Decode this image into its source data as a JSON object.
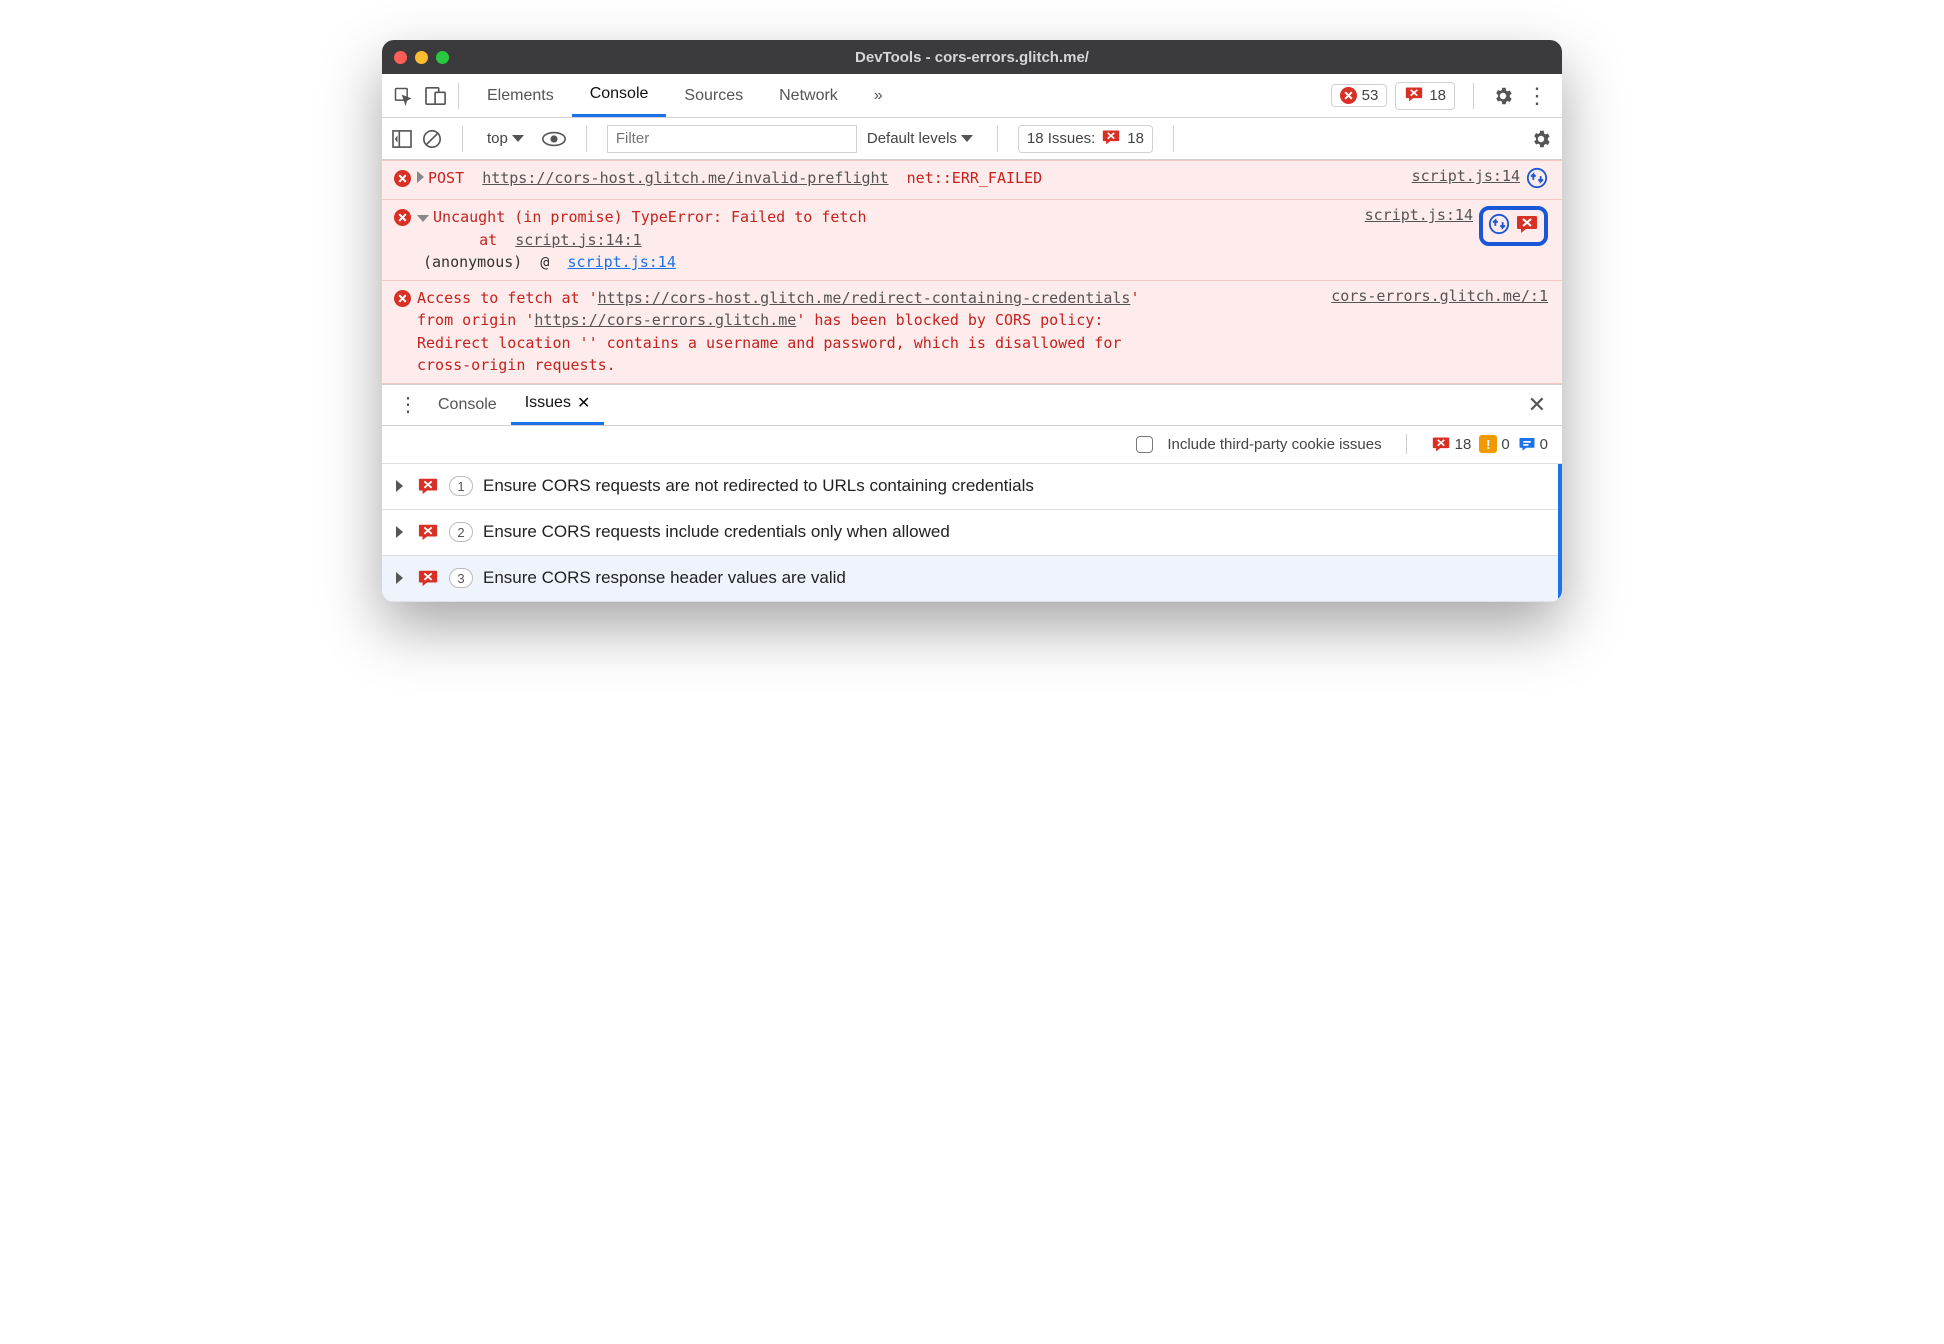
{
  "title": "DevTools - cors-errors.glitch.me/",
  "toolbar": {
    "tabs": [
      "Elements",
      "Console",
      "Sources",
      "Network"
    ],
    "active_tab": "Console",
    "overflow": "»",
    "error_count": "53",
    "issue_count": "18"
  },
  "subtoolbar": {
    "context": "top",
    "filter_placeholder": "Filter",
    "levels_label": "Default levels",
    "issues_label": "18 Issues:",
    "issues_count": "18"
  },
  "messages": {
    "m1": {
      "method": "POST",
      "url": "https://cors-host.glitch.me/invalid-preflight",
      "err": "net::ERR_FAILED",
      "source": "script.js:14"
    },
    "m2": {
      "text": "Uncaught (in promise) TypeError: Failed to fetch",
      "at_prefix": "at",
      "at_link": "script.js:14:1",
      "source": "script.js:14",
      "anon_label": "(anonymous)",
      "anon_at": "@",
      "anon_link": "script.js:14"
    },
    "m3": {
      "pre": "Access to fetch at '",
      "url1": "https://cors-host.glitch.me/redirect-containing-credentials",
      "mid1": "' from origin '",
      "url2": "https://cors-errors.glitch.me",
      "post": "' has been blocked by CORS policy: Redirect location '' contains a username and password, which is disallowed for cross-origin requests.",
      "source": "cors-errors.glitch.me/:1"
    }
  },
  "drawer": {
    "tabs": {
      "console": "Console",
      "issues": "Issues"
    },
    "subbar": {
      "checkbox_label": "Include third-party cookie issues",
      "red": "18",
      "orange": "0",
      "blue": "0"
    },
    "issues": [
      {
        "count": "1",
        "title": "Ensure CORS requests are not redirected to URLs containing credentials"
      },
      {
        "count": "2",
        "title": "Ensure CORS requests include credentials only when allowed"
      },
      {
        "count": "3",
        "title": "Ensure CORS response header values are valid"
      }
    ]
  }
}
